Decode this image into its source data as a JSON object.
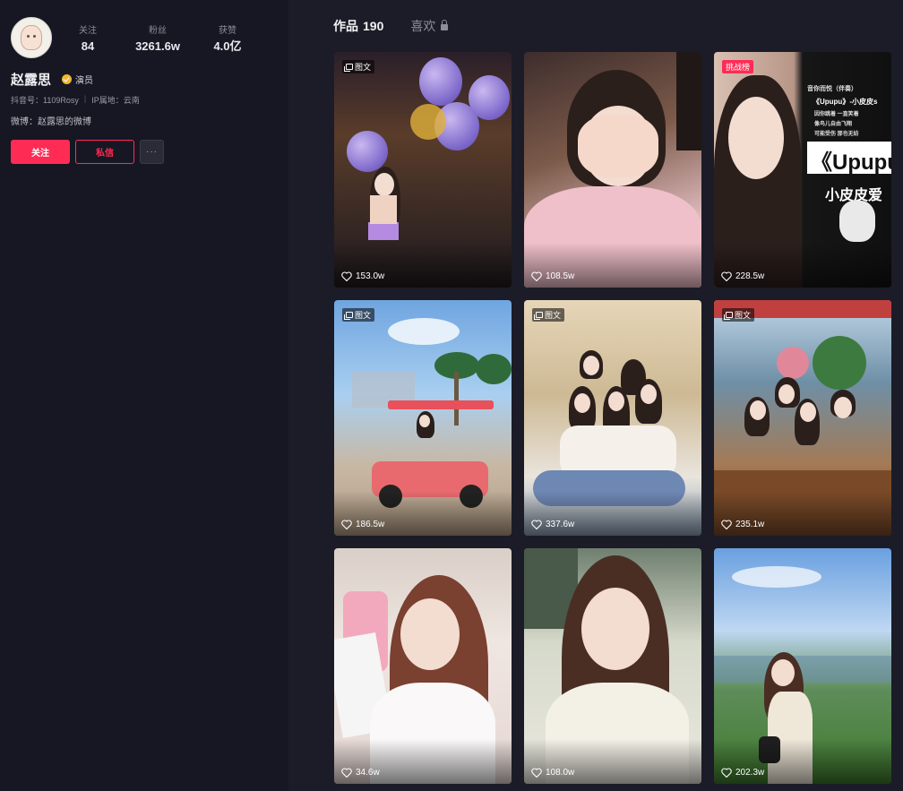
{
  "profile": {
    "name": "赵露思",
    "role": "演员",
    "douyin_id": "抖音号：1109Rosy",
    "ip_location": "IP属地：云南",
    "weibo": "微博：赵露思的微博",
    "stats": [
      {
        "label": "关注",
        "value": "84"
      },
      {
        "label": "粉丝",
        "value": "3261.6w"
      },
      {
        "label": "获赞",
        "value": "4.0亿"
      }
    ],
    "buttons": {
      "follow": "关注",
      "message": "私信",
      "more": "···"
    }
  },
  "tabs": [
    {
      "label": "作品",
      "count": "190",
      "active": true
    },
    {
      "label": "喜欢",
      "count": "",
      "active": false,
      "locked": true
    }
  ],
  "posts": [
    {
      "likes": "153.0w",
      "tag": "图文"
    },
    {
      "likes": "108.5w",
      "tag": ""
    },
    {
      "likes": "228.5w",
      "tag": "挑战榜",
      "overlay_lines": [
        "音你而悦（伴奏）",
        "《Upupu》-小皮皮s",
        "因你跳着 一直笑着",
        "像鸟儿自由飞翔",
        "可能受伤 那也无妨",
        "《Upupu",
        "小皮皮爱"
      ]
    },
    {
      "likes": "186.5w",
      "tag": "图文"
    },
    {
      "likes": "337.6w",
      "tag": "图文"
    },
    {
      "likes": "235.1w",
      "tag": "图文"
    },
    {
      "likes": "34.6w",
      "tag": ""
    },
    {
      "likes": "108.0w",
      "tag": ""
    },
    {
      "likes": "202.3w",
      "tag": ""
    }
  ],
  "colors": {
    "accent": "#fe2c55",
    "background": "#161722",
    "verified": "#f4b532"
  }
}
